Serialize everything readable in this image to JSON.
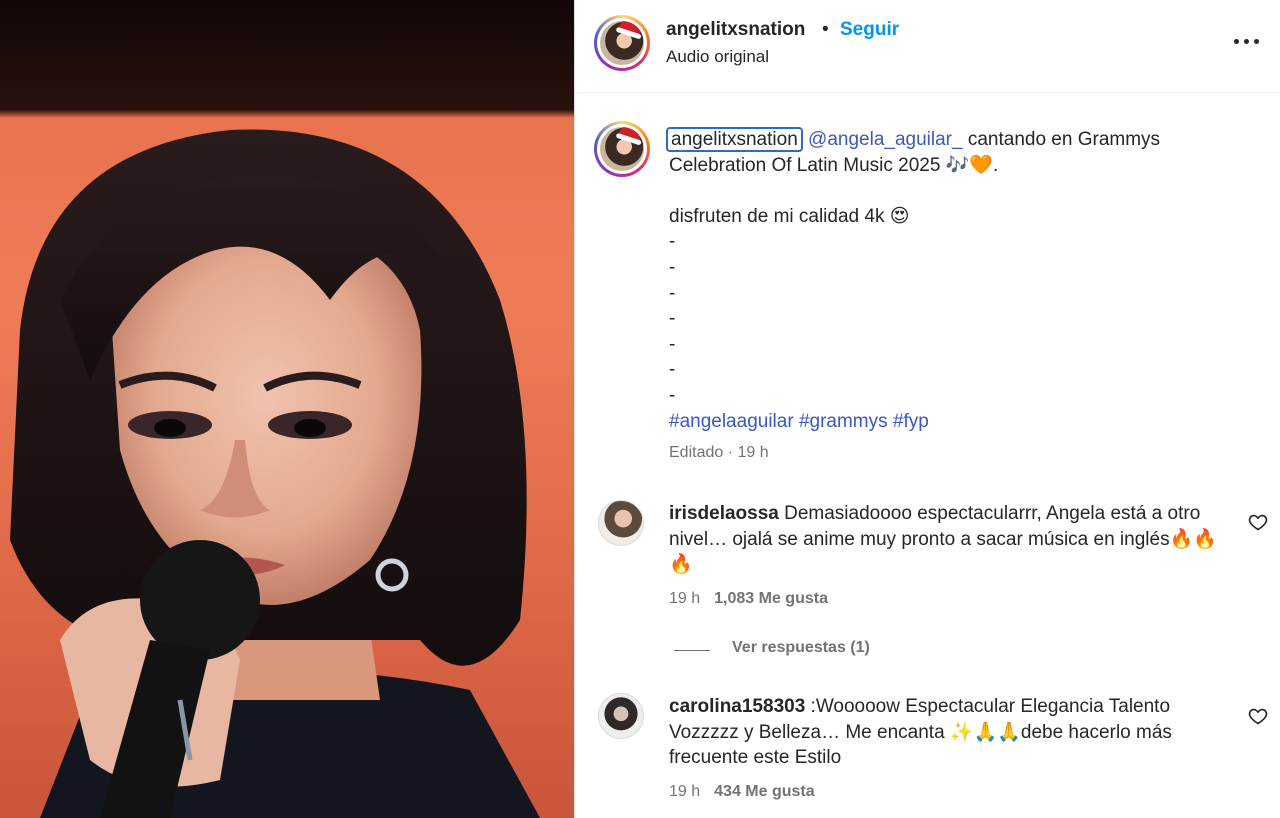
{
  "post": {
    "username": "angelitxsnation",
    "dot": "•",
    "follow_label": "Seguir",
    "audio": "Audio original",
    "more_icon": "more-options-icon"
  },
  "caption": {
    "username": "angelitxsnation",
    "mention": "@angela_aguilar_",
    "text_after_mention": " cantando en Grammys",
    "line2": "Celebration Of Latin Music 2025 🎶🧡.",
    "line3": "disfruten de mi calidad 4k 😍",
    "dashes": [
      "-",
      "-",
      "-",
      "-",
      "-",
      "-",
      "-"
    ],
    "hashtags": [
      "#angelaaguilar",
      "#grammys",
      "#fyp"
    ],
    "meta": "Editado · 19 h"
  },
  "comments": [
    {
      "username": "irisdelaossa",
      "text": " Demasiadoooo espectacularrr, Angela está a otro nivel… ojalá se anime muy pronto a sacar música en inglés🔥🔥🔥",
      "time": "19 h",
      "likes": "1,083 Me gusta",
      "replies_label": "Ver respuestas (1)"
    },
    {
      "username": "carolina158303",
      "text": " :Wooooow Espectacular Elegancia Talento Vozzzzz y Belleza… Me encanta ✨🙏🙏debe hacerlo más frecuente este Estilo",
      "time": "19 h",
      "likes": "434 Me gusta"
    }
  ],
  "colors": {
    "accent_blue": "#0095f6",
    "link_blue": "#3b57c4",
    "muted": "#737373",
    "text": "#262626"
  }
}
